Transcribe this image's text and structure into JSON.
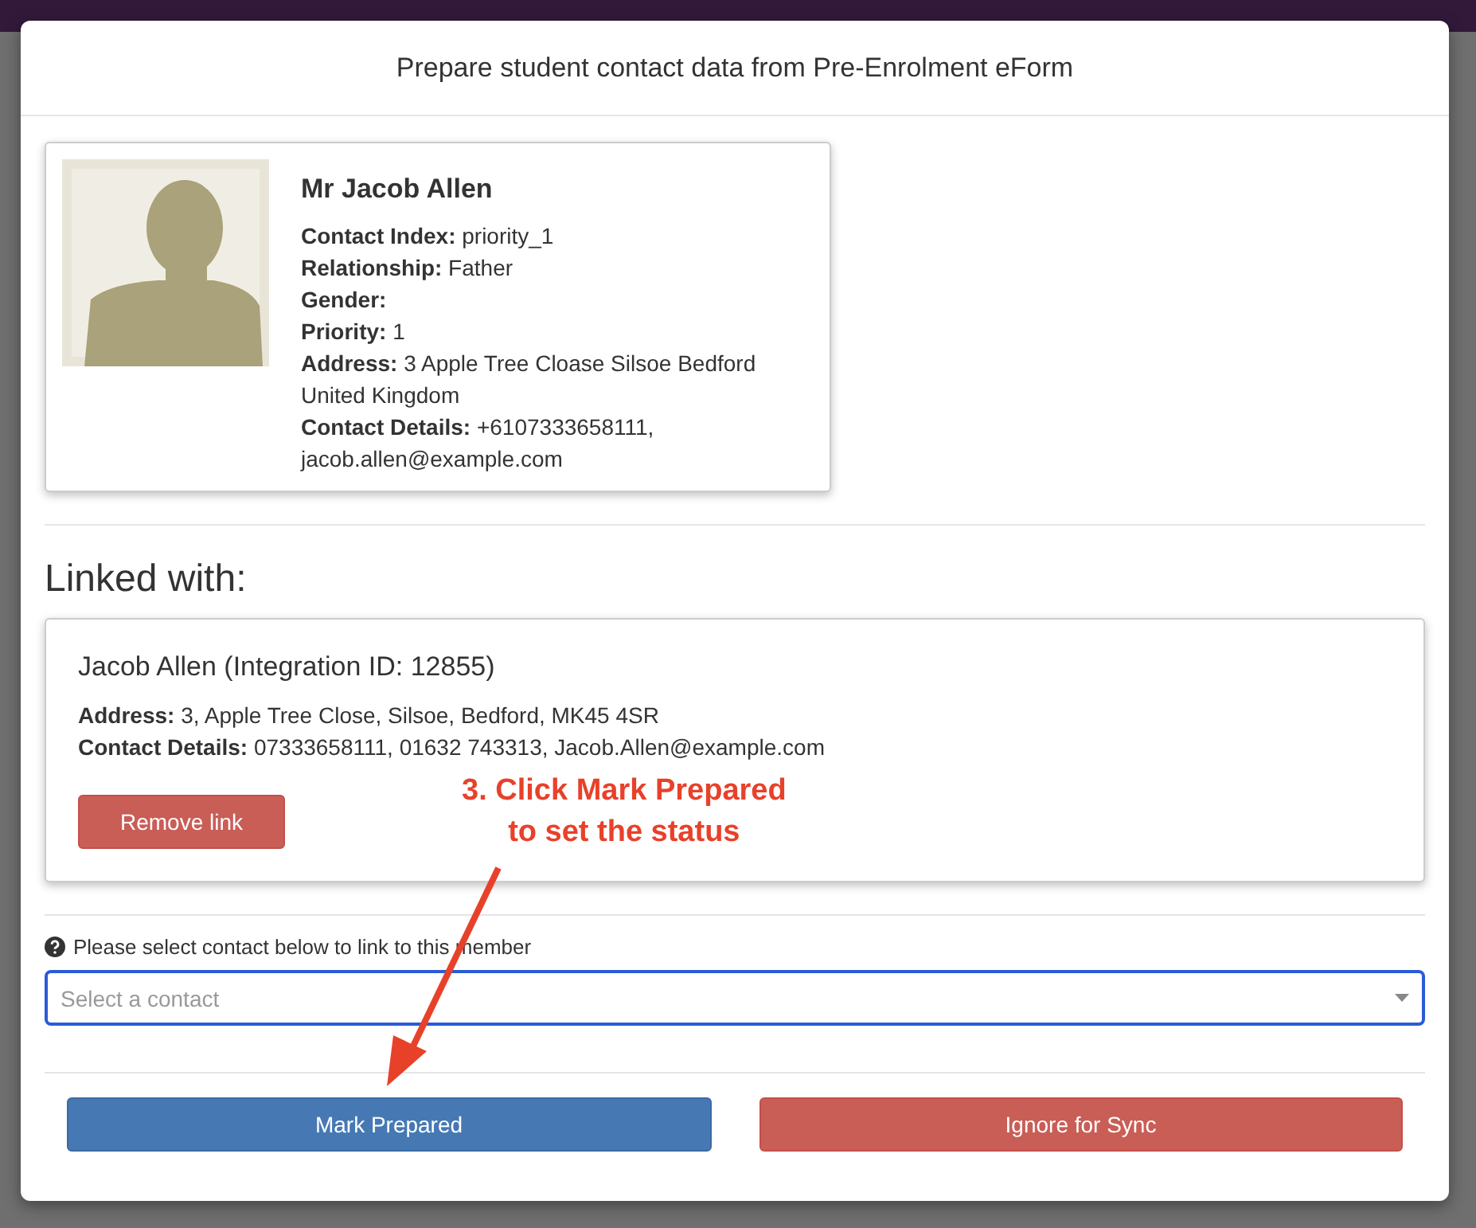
{
  "modal": {
    "title": "Prepare student contact data from Pre-Enrolment eForm"
  },
  "contact": {
    "kind": "picture",
    "name": "Mr Jacob Allen",
    "fields": [
      {
        "label": "Contact Index:",
        "value": "priority_1"
      },
      {
        "label": "Relationship:",
        "value": "Father"
      },
      {
        "label": "Gender:"
      },
      {
        "label": "Priority:",
        "value": "1"
      },
      {
        "label": "Address:",
        "value": "3 Apple Tree Cloase Silsoe Bedford United Kingdom"
      },
      {
        "label": "Contact Details:",
        "value": "+6107333658111, jacob.allen@example.com"
      }
    ]
  },
  "linked_heading": "Linked with:",
  "linked": {
    "title": "Jacob Allen (Integration ID: 12855)",
    "fields": [
      {
        "label": "Address:",
        "value": "3, Apple Tree Close, Silsoe, Bedford, MK45 4SR"
      },
      {
        "label": "Contact Details:",
        "value": "07333658111, 01632 743313, Jacob.Allen@example.com"
      }
    ],
    "button": "Remove link"
  },
  "select": {
    "help": "Please select contact below to link to this member",
    "placeholder": "Select a contact"
  },
  "buttons": [
    {
      "label": "Mark Prepared",
      "kind": "primary"
    },
    {
      "label": "Ignore for Sync",
      "kind": "danger"
    }
  ],
  "annotation": {
    "lines": [
      "3. Click Mark Prepared",
      "to set the status"
    ]
  }
}
